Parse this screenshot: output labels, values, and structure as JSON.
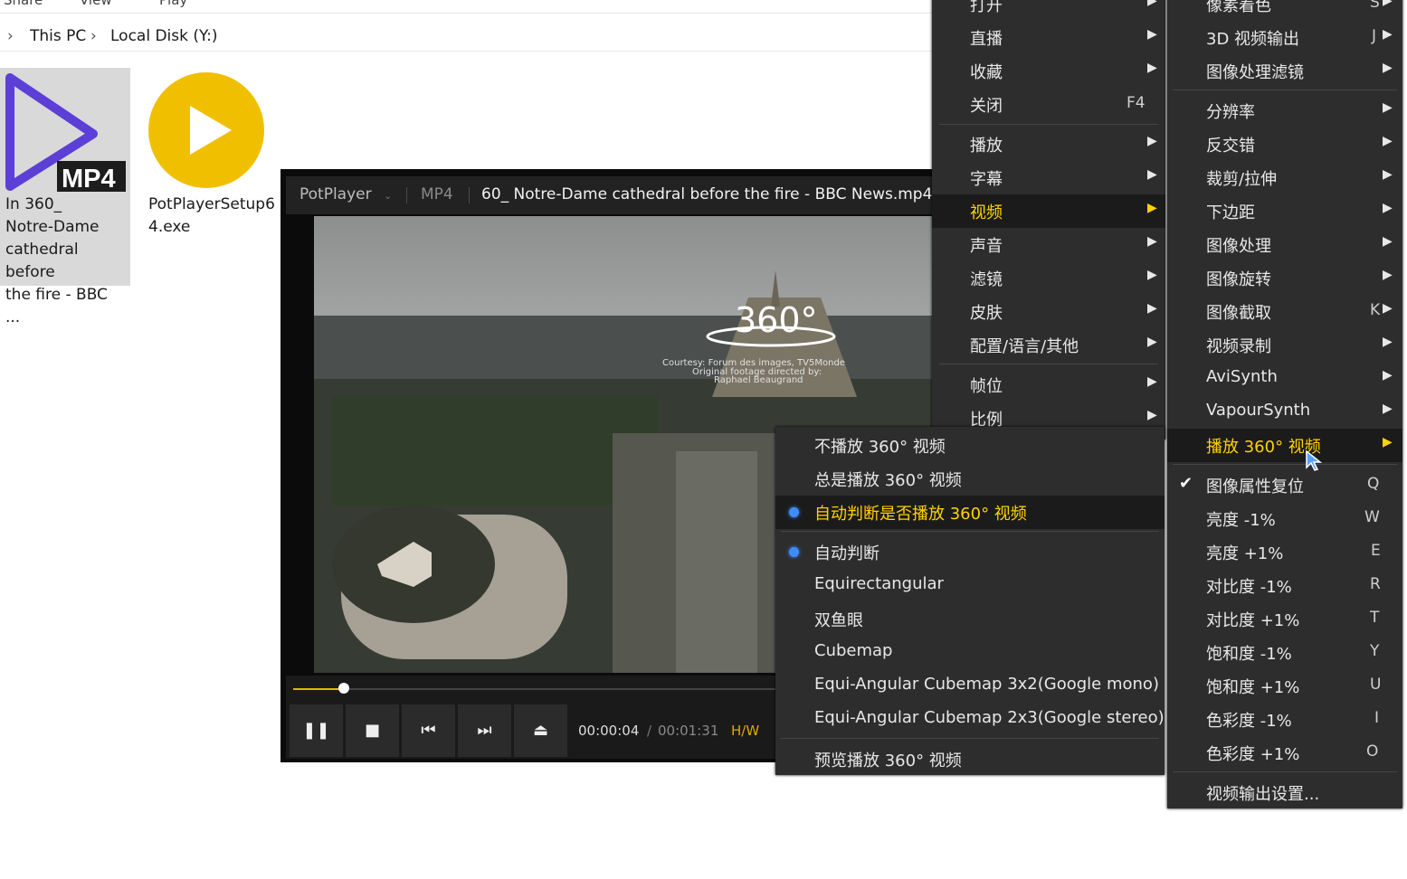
{
  "explorer": {
    "ribbon": [
      "Share",
      "View",
      "Play"
    ],
    "breadcrumb": [
      "This PC",
      "Local Disk (Y:)"
    ],
    "files": [
      {
        "label": "In 360_\nNotre-Dame\ncathedral before\nthe fire - BBC ...",
        "badge": "MP4",
        "icon": "mp4-video-file-icon",
        "selected": true
      },
      {
        "label": "PotPlayerSetup6\n4.exe",
        "icon": "potplayer-setup-icon",
        "selected": false
      }
    ]
  },
  "player": {
    "app_name": "PotPlayer",
    "format": "MP4",
    "title": "60_ Notre-Dame cathedral before the fire -  BBC News.mp4",
    "overlay": {
      "logo": "360°",
      "credit": [
        "Courtesy: Forum des images, TV5Monde",
        "Original footage directed by:",
        "Raphael Beaugrand"
      ]
    },
    "progress": 0.08,
    "time_current": "00:00:04",
    "time_separator": "/",
    "time_total": "00:01:31",
    "hw": "H/W",
    "controls": [
      "pause-icon",
      "stop-icon",
      "previous-icon",
      "next-icon",
      "eject-icon"
    ]
  },
  "main_menu": {
    "items": [
      {
        "label": "打开",
        "arrow": "▶"
      },
      {
        "label": "直播",
        "arrow": "▶"
      },
      {
        "label": "收藏",
        "arrow": "▶"
      },
      {
        "label": "关闭",
        "shortcut": "F4"
      },
      {
        "label": "播放",
        "arrow": "▶"
      },
      {
        "label": "字幕",
        "arrow": "▶"
      },
      {
        "label": "视频",
        "arrow": "▶",
        "highlight": true
      },
      {
        "label": "声音",
        "arrow": "▶"
      },
      {
        "label": "滤镜",
        "arrow": "▶"
      },
      {
        "label": "皮肤",
        "arrow": "▶"
      },
      {
        "label": "配置/语言/其他",
        "arrow": "▶"
      },
      {
        "label": "帧位",
        "arrow": "▶"
      },
      {
        "label": "比例",
        "arrow": "▶"
      }
    ]
  },
  "video_menu": {
    "items": [
      {
        "label": "像素着色",
        "shortcut": "S",
        "arrow": "▶"
      },
      {
        "label": "3D 视频输出",
        "shortcut": "J",
        "arrow": "▶"
      },
      {
        "label": "图像处理滤镜",
        "arrow": "▶"
      },
      {
        "label": "分辨率",
        "arrow": "▶"
      },
      {
        "label": "反交错",
        "arrow": "▶"
      },
      {
        "label": "裁剪/拉伸",
        "arrow": "▶"
      },
      {
        "label": "下边距",
        "arrow": "▶"
      },
      {
        "label": "图像处理",
        "arrow": "▶"
      },
      {
        "label": "图像旋转",
        "arrow": "▶"
      },
      {
        "label": "图像截取",
        "shortcut": "K",
        "arrow": "▶"
      },
      {
        "label": "视频录制",
        "arrow": "▶"
      },
      {
        "label": "AviSynth",
        "arrow": "▶"
      },
      {
        "label": "VapourSynth",
        "arrow": "▶"
      },
      {
        "label": "播放 360° 视频",
        "arrow": "▶",
        "highlight": true
      },
      {
        "label": "图像属性复位",
        "shortcut": "Q",
        "checked": true
      },
      {
        "label": "亮度 -1%",
        "shortcut": "W"
      },
      {
        "label": "亮度 +1%",
        "shortcut": "E"
      },
      {
        "label": "对比度 -1%",
        "shortcut": "R"
      },
      {
        "label": "对比度 +1%",
        "shortcut": "T"
      },
      {
        "label": "饱和度 -1%",
        "shortcut": "Y"
      },
      {
        "label": "饱和度 +1%",
        "shortcut": "U"
      },
      {
        "label": "色彩度 -1%",
        "shortcut": "I"
      },
      {
        "label": "色彩度 +1%",
        "shortcut": "O"
      },
      {
        "label": "视频输出设置..."
      }
    ]
  },
  "sub360_menu": {
    "items": [
      {
        "label": "不播放 360° 视频"
      },
      {
        "label": "总是播放 360° 视频"
      },
      {
        "label": "自动判断是否播放 360° 视频",
        "radio": true,
        "highlight": true
      },
      {
        "label": "自动判断",
        "radio": true
      },
      {
        "label": "Equirectangular"
      },
      {
        "label": "双鱼眼"
      },
      {
        "label": "Cubemap"
      },
      {
        "label": "Equi-Angular Cubemap 3x2(Google mono)"
      },
      {
        "label": "Equi-Angular Cubemap 2x3(Google stereo)"
      },
      {
        "label": "预览播放 360° 视频"
      }
    ]
  },
  "colors": {
    "accent": "#ffd200",
    "menu_bg": "#2d2d2d",
    "radio": "#3d8cff",
    "progress": "#e0b800"
  }
}
